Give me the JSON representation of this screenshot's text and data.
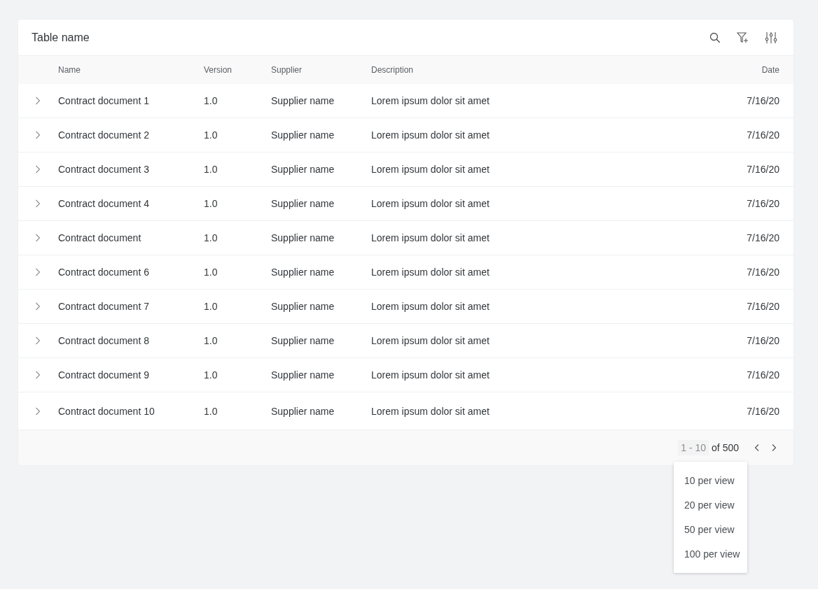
{
  "table": {
    "title": "Table name",
    "columns": [
      "Name",
      "Version",
      "Supplier",
      "Description",
      "Date"
    ],
    "rows": [
      {
        "name": "Contract document 1",
        "version": "1.0",
        "supplier": "Supplier name",
        "description": "Lorem ipsum dolor sit amet",
        "date": "7/16/20"
      },
      {
        "name": "Contract document 2",
        "version": "1.0",
        "supplier": "Supplier name",
        "description": "Lorem ipsum dolor sit amet",
        "date": "7/16/20"
      },
      {
        "name": "Contract document 3",
        "version": "1.0",
        "supplier": "Supplier name",
        "description": "Lorem ipsum dolor sit amet",
        "date": "7/16/20"
      },
      {
        "name": "Contract document 4",
        "version": "1.0",
        "supplier": "Supplier name",
        "description": "Lorem ipsum dolor sit amet",
        "date": "7/16/20"
      },
      {
        "name": "Contract document",
        "version": "1.0",
        "supplier": "Supplier name",
        "description": "Lorem ipsum dolor sit amet",
        "date": "7/16/20"
      },
      {
        "name": "Contract document 6",
        "version": "1.0",
        "supplier": "Supplier name",
        "description": "Lorem ipsum dolor sit amet",
        "date": "7/16/20"
      },
      {
        "name": "Contract document 7",
        "version": "1.0",
        "supplier": "Supplier name",
        "description": "Lorem ipsum dolor sit amet",
        "date": "7/16/20"
      },
      {
        "name": "Contract document 8",
        "version": "1.0",
        "supplier": "Supplier name",
        "description": "Lorem ipsum dolor sit amet",
        "date": "7/16/20"
      },
      {
        "name": "Contract document 9",
        "version": "1.0",
        "supplier": "Supplier name",
        "description": "Lorem ipsum dolor sit amet",
        "date": "7/16/20"
      },
      {
        "name": "Contract document 10",
        "version": "1.0",
        "supplier": "Supplier name",
        "description": "Lorem ipsum dolor sit amet",
        "date": "7/16/20"
      }
    ],
    "pagination": {
      "range": "1 - 10",
      "total": "of 500"
    },
    "page_size_menu": [
      "10 per view",
      "20 per view",
      "50 per view",
      "100 per view"
    ]
  }
}
